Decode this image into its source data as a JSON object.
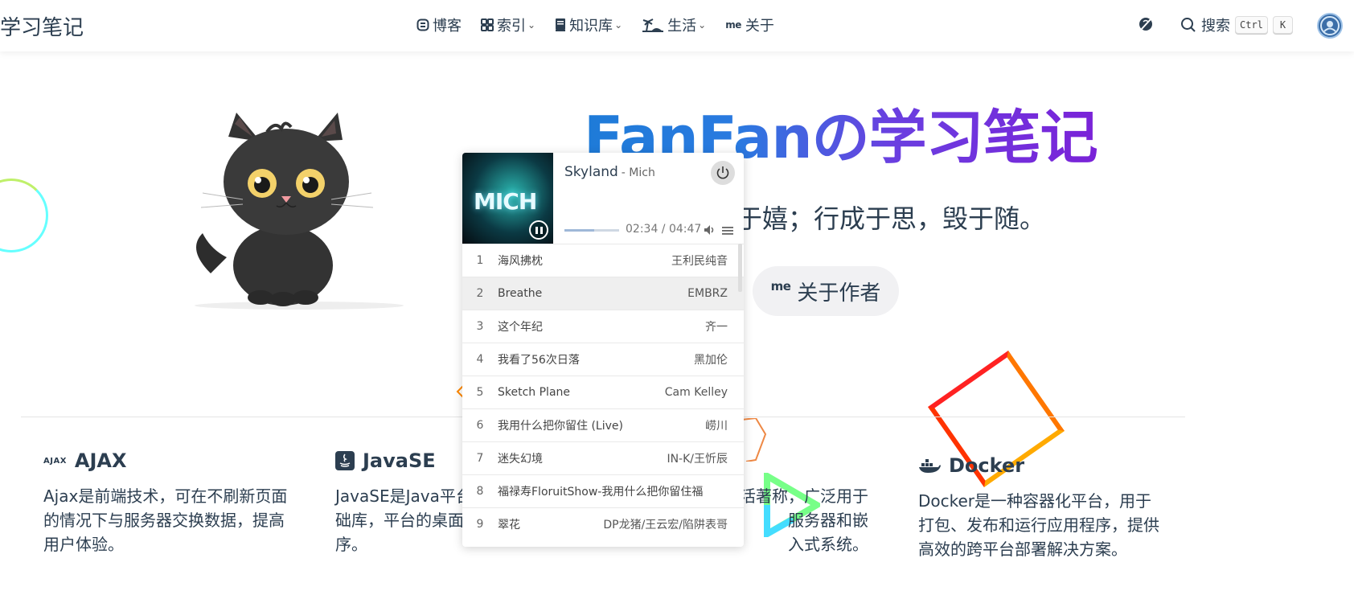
{
  "navbar": {
    "site_title": "学习笔记",
    "items": [
      {
        "label": "博客",
        "icon": "blog-icon",
        "dropdown": false
      },
      {
        "label": "索引",
        "icon": "grid-icon",
        "dropdown": true
      },
      {
        "label": "知识库",
        "icon": "book-icon",
        "dropdown": true
      },
      {
        "label": "生活",
        "icon": "beach-icon",
        "dropdown": true
      },
      {
        "label": "关于",
        "icon": "me-icon",
        "icon_text": "me",
        "dropdown": false
      }
    ],
    "search": {
      "label": "搜索",
      "kbd_ctrl": "Ctrl",
      "kbd_k": "K"
    }
  },
  "hero": {
    "title": "FanFanの学习笔记",
    "tagline": "于嬉；行成于思，毁于随。",
    "about_button": {
      "icon_text": "me",
      "label": "关于作者"
    }
  },
  "player": {
    "cover_text": "MICH",
    "track_title": "Skyland",
    "track_artist": "- Mich",
    "time": "02:34 / 04:47",
    "progress": 0.54,
    "playlist": [
      {
        "num": "1",
        "title": "海风拂枕",
        "artist": "王利民纯音"
      },
      {
        "num": "2",
        "title": "Breathe",
        "artist": "EMBRZ"
      },
      {
        "num": "3",
        "title": "这个年纪",
        "artist": "齐一"
      },
      {
        "num": "4",
        "title": "我看了56次日落",
        "artist": "黑加伦"
      },
      {
        "num": "5",
        "title": "Sketch Plane",
        "artist": "Cam Kelley"
      },
      {
        "num": "6",
        "title": "我用什么把你留住 (Live)",
        "artist": "崂川"
      },
      {
        "num": "7",
        "title": "迷失幻境",
        "artist": "IN-K/王忻辰"
      },
      {
        "num": "8",
        "title": "福禄寿FloruitShow-我用什么把你留住福",
        "artist": ""
      },
      {
        "num": "9",
        "title": "翠花",
        "artist": "DP龙猪/王云宏/陷阱表哥"
      }
    ]
  },
  "features": [
    {
      "icon_text": "AJAX",
      "title": "AJAX",
      "desc": "Ajax是前端技术，可在不刷新页面的情况下与服务器交换数据，提高用户体验。"
    },
    {
      "title": "JavaSE",
      "desc": "JavaSE是Java平台的核心功能和基础库，平台的桌面和嵌入式应用程序。"
    },
    {
      "title": "",
      "desc": "源操作系统，以活著称，广泛用于服务器和嵌入式系统。"
    },
    {
      "title": "Docker",
      "desc": "Docker是一种容器化平台，用于打包、发布和运行应用程序，提供高效的跨平台部署解决方案。"
    }
  ]
}
